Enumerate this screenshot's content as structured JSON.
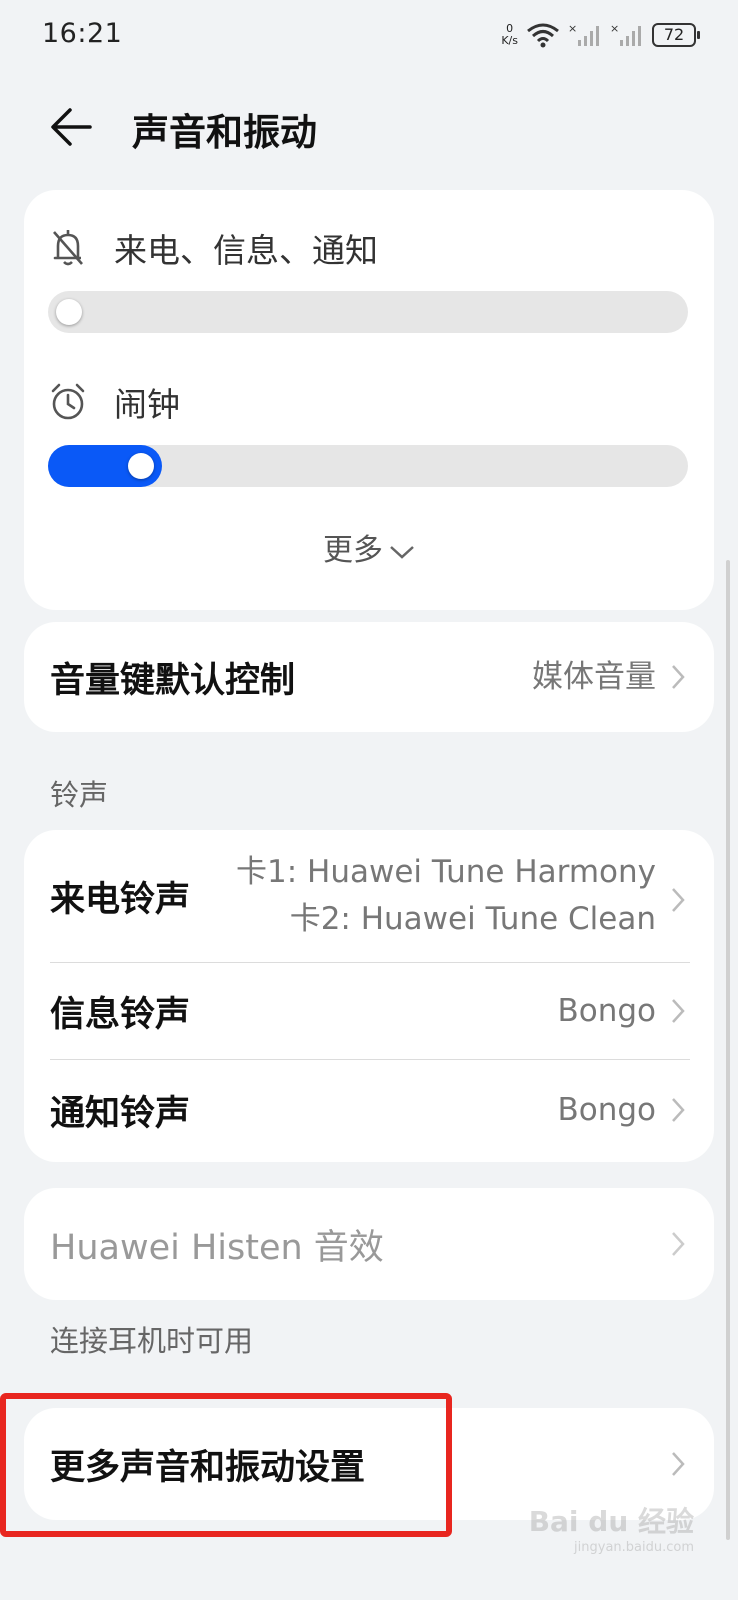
{
  "status_bar": {
    "time": "16:21",
    "net_speed_value": "0",
    "net_speed_unit": "K/s",
    "battery": "72"
  },
  "header": {
    "title": "声音和振动"
  },
  "volume": {
    "ring_label": "来电、信息、通知",
    "ring_level": 0,
    "alarm_label": "闹钟",
    "alarm_level": 0.12,
    "more_label": "更多",
    "accent_color": "#0a59f7"
  },
  "volume_key": {
    "title": "音量键默认控制",
    "value": "媒体音量"
  },
  "ringtones": {
    "section_label": "铃声",
    "call": {
      "title": "来电铃声",
      "value_line1": "卡1: Huawei Tune Harmony",
      "value_line2": "卡2: Huawei Tune Clean"
    },
    "message": {
      "title": "信息铃声",
      "value": "Bongo"
    },
    "notification": {
      "title": "通知铃声",
      "value": "Bongo"
    }
  },
  "histen": {
    "title": "Huawei Histen 音效",
    "note": "连接耳机时可用"
  },
  "more_settings": {
    "title": "更多声音和振动设置"
  },
  "watermark": {
    "text": "Bai du 经验",
    "sub": "jingyan.baidu.com"
  }
}
